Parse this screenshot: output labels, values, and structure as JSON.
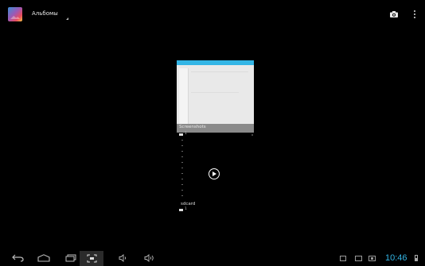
{
  "action_bar": {
    "title": "Альбомы",
    "app_icon": "gallery-app-icon",
    "actions": [
      "camera-icon",
      "overflow-menu-icon"
    ]
  },
  "album": {
    "caption": "Screenshots",
    "count": "1"
  },
  "sdcard": {
    "label": "sdcard",
    "count": "1"
  },
  "system_bar": {
    "clock": "10:46",
    "nav_buttons": [
      "back-icon",
      "home-icon",
      "recents-icon",
      "screenshot-icon",
      "volume-down-icon",
      "volume-up-icon"
    ],
    "status_icons": [
      "notification-icon",
      "notification-icon",
      "notification-icon",
      "battery-icon"
    ],
    "clock_color": "#33b5e5"
  },
  "colors": {
    "background": "#000000",
    "accent": "#33b5e5"
  }
}
